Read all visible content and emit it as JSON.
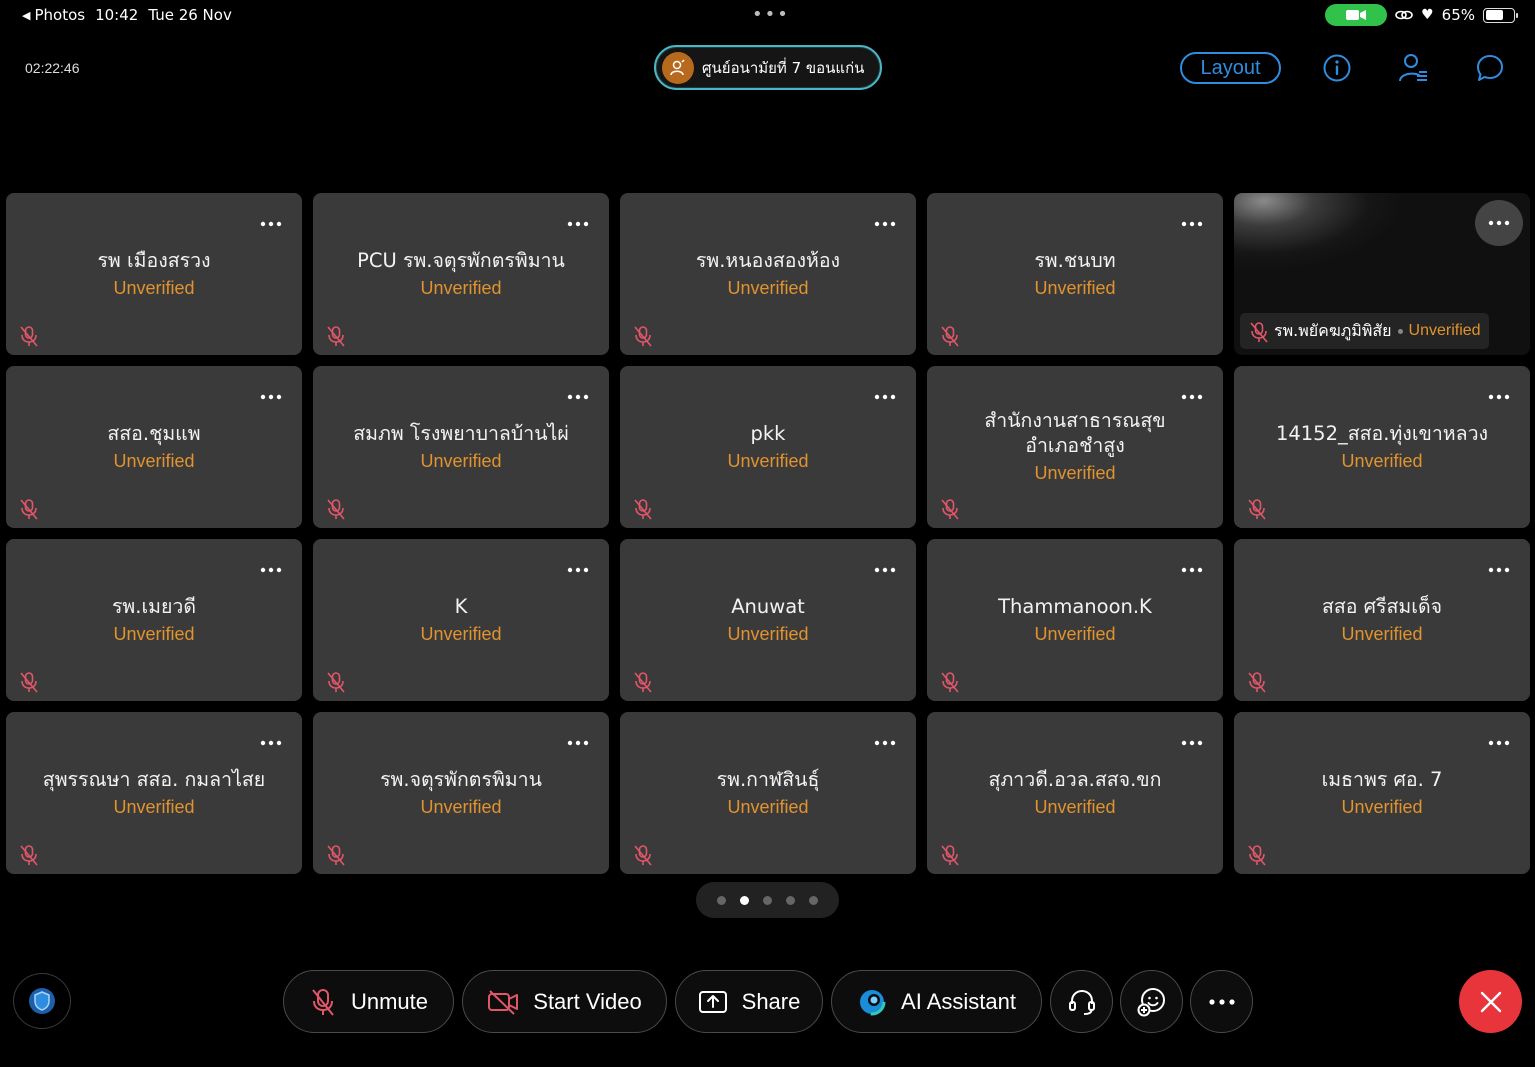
{
  "status_bar": {
    "back_app": "Photos",
    "time": "10:42",
    "date": "Tue 26 Nov",
    "battery": "65%",
    "battery_level": 0.65
  },
  "header": {
    "timer": "02:22:46",
    "host_name": "ศูนย์อนามัยที่ 7 ขอนแก่น",
    "layout_label": "Layout",
    "icons": [
      "info-icon",
      "participants-icon",
      "chat-icon"
    ]
  },
  "participants": [
    {
      "name": "รพ เมืองสรวง",
      "status": "Unverified"
    },
    {
      "name": "PCU รพ.จตุรพักตรพิมาน",
      "status": "Unverified"
    },
    {
      "name": "รพ.หนองสองห้อง",
      "status": "Unverified"
    },
    {
      "name": "รพ.ชนบท",
      "status": "Unverified"
    },
    {
      "name": "รพ.พยัคฆภูมิพิสัย",
      "status": "Unverified"
    },
    {
      "name": "สสอ.ชุมแพ",
      "status": "Unverified"
    },
    {
      "name": "สมภพ โรงพยาบาลบ้านไผ่",
      "status": "Unverified"
    },
    {
      "name": "pkk",
      "status": "Unverified"
    },
    {
      "name": "สำนักงานสาธารณสุขอำเภอชำสูง",
      "status": "Unverified"
    },
    {
      "name": "14152_สสอ.ทุ่งเขาหลวง",
      "status": "Unverified"
    },
    {
      "name": "รพ.เมยวดี",
      "status": "Unverified"
    },
    {
      "name": "K",
      "status": "Unverified"
    },
    {
      "name": "Anuwat",
      "status": "Unverified"
    },
    {
      "name": "Thammanoon.K",
      "status": "Unverified"
    },
    {
      "name": "สสอ ศรีสมเด็จ",
      "status": "Unverified"
    },
    {
      "name": "สุพรรณษา สสอ. กมลาไสย",
      "status": "Unverified"
    },
    {
      "name": "รพ.จตุรพักตรพิมาน",
      "status": "Unverified"
    },
    {
      "name": "รพ.กาฬสินธุ์",
      "status": "Unverified"
    },
    {
      "name": "สุภาวดี.อวล.สสจ.ขก",
      "status": "Unverified"
    },
    {
      "name": "เมธาพร ศอ. 7",
      "status": "Unverified"
    }
  ],
  "pager": {
    "pages": 5,
    "current": 2
  },
  "toolbar": {
    "unmute_label": "Unmute",
    "start_video_label": "Start Video",
    "share_label": "Share",
    "ai_assistant_label": "AI Assistant"
  },
  "colors": {
    "unverified": "#e0932f",
    "tile_bg": "#3a3a3a",
    "accent_blue": "#2f8de0",
    "end_call": "#e8353c",
    "muted_mic": "#e2566a"
  }
}
